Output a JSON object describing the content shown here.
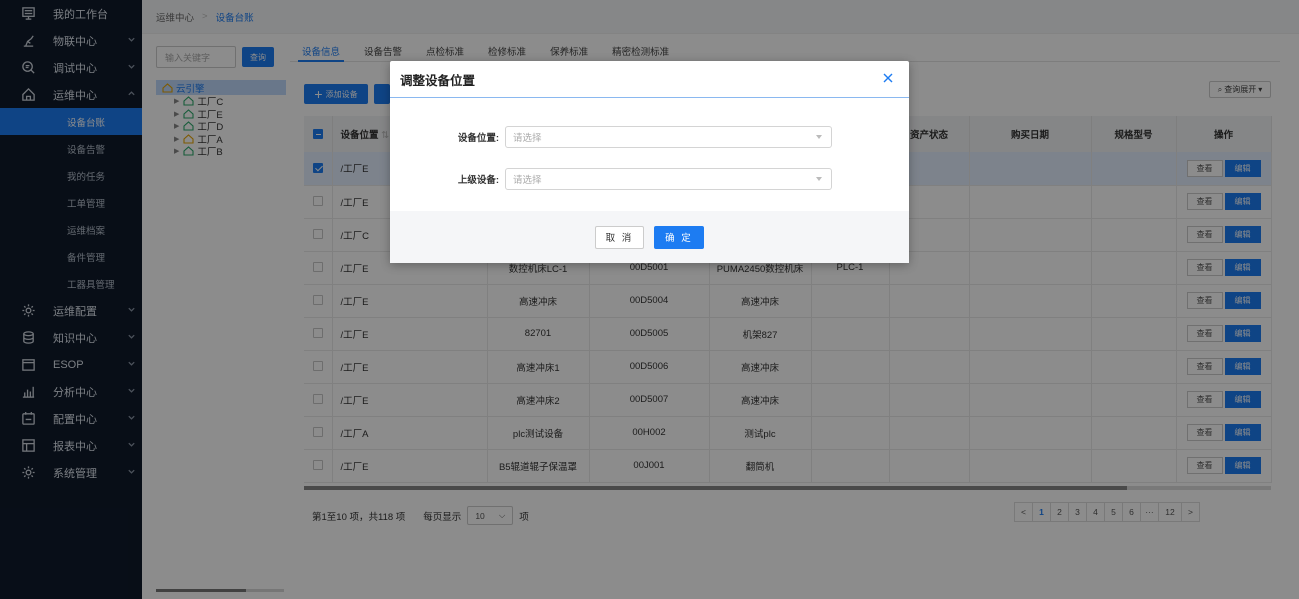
{
  "sidebar": {
    "items": [
      {
        "label": "我的工作台",
        "icon": "monitor-icon",
        "chevron": false
      },
      {
        "label": "物联中心",
        "icon": "robot-arm-icon",
        "chevron": true
      },
      {
        "label": "调试中心",
        "icon": "debug-icon",
        "chevron": true
      },
      {
        "label": "运维中心",
        "icon": "maintenance-icon",
        "chevron": true,
        "expanded": true
      }
    ],
    "sub_items": [
      "设备台账",
      "设备告警",
      "我的任务",
      "工单管理",
      "运维档案",
      "备件管理",
      "工器具管理"
    ],
    "items_after": [
      {
        "label": "运维配置",
        "icon": "gear-icon"
      },
      {
        "label": "知识中心",
        "icon": "database-icon"
      },
      {
        "label": "ESOP",
        "icon": "esop-icon"
      },
      {
        "label": "分析中心",
        "icon": "analytics-icon"
      },
      {
        "label": "配置中心",
        "icon": "config-icon"
      },
      {
        "label": "报表中心",
        "icon": "report-icon"
      },
      {
        "label": "系统管理",
        "icon": "settings-icon"
      }
    ],
    "active_sub": "设备台账"
  },
  "breadcrumb": {
    "parent": "运维中心",
    "sep": ">",
    "current": "设备台账"
  },
  "tree": {
    "search_placeholder": "输入关键字",
    "search_label": "查询",
    "root": "云引擎",
    "children": [
      "工厂C",
      "工厂E",
      "工厂D",
      "工厂A",
      "工厂B"
    ]
  },
  "tabs": [
    "设备信息",
    "设备告警",
    "点检标准",
    "检修标准",
    "保养标准",
    "精密检测标准"
  ],
  "toolbar": {
    "add_label": "添加设备",
    "query_expand": "查询展开"
  },
  "table": {
    "headers": {
      "location": "设备位置",
      "asset_status": "资产状态",
      "purchase_date": "购买日期",
      "spec": "规格型号",
      "ops": "操作"
    },
    "rows": [
      {
        "loc": "/工厂E",
        "name": "",
        "code": "",
        "model": "",
        "plc": "",
        "selected": true
      },
      {
        "loc": "/工厂E",
        "name": "",
        "code": "",
        "model": "",
        "plc": ""
      },
      {
        "loc": "/工厂C",
        "name": "",
        "code": "",
        "model": "",
        "plc": ""
      },
      {
        "loc": "/工厂E",
        "name": "数控机床LC-1",
        "code": "00D5001",
        "model": "PUMA2450数控机床",
        "plc": "PLC-1"
      },
      {
        "loc": "/工厂E",
        "name": "高速冲床",
        "code": "00D5004",
        "model": "高速冲床",
        "plc": ""
      },
      {
        "loc": "/工厂E",
        "name": "82701",
        "code": "00D5005",
        "model": "机架827",
        "plc": ""
      },
      {
        "loc": "/工厂E",
        "name": "高速冲床1",
        "code": "00D5006",
        "model": "高速冲床",
        "plc": ""
      },
      {
        "loc": "/工厂E",
        "name": "高速冲床2",
        "code": "00D5007",
        "model": "高速冲床",
        "plc": ""
      },
      {
        "loc": "/工厂A",
        "name": "plc测试设备",
        "code": "00H002",
        "model": "测试plc",
        "plc": ""
      },
      {
        "loc": "/工厂E",
        "name": "B5辊道辊子保温罩",
        "code": "00J001",
        "model": "翻筒机",
        "plc": ""
      }
    ],
    "view_label": "查看",
    "edit_label": "编辑"
  },
  "pagination": {
    "summary": "第1至10 项，共118 项",
    "per_page_label": "每页显示",
    "per_page": "10",
    "unit": "项",
    "pages": [
      "<",
      "1",
      "2",
      "3",
      "4",
      "5",
      "6",
      "···",
      "12",
      ">"
    ],
    "current": "1"
  },
  "dialog": {
    "title": "调整设备位置",
    "close": "×",
    "location_label": "设备位置:",
    "location_placeholder": "请选择",
    "parent_label": "上级设备:",
    "parent_placeholder": "请选择",
    "cancel": "取 消",
    "ok": "确 定"
  },
  "colors": {
    "accent": "#1d7cf2",
    "sidebar_bg": "#0f1a2b"
  }
}
